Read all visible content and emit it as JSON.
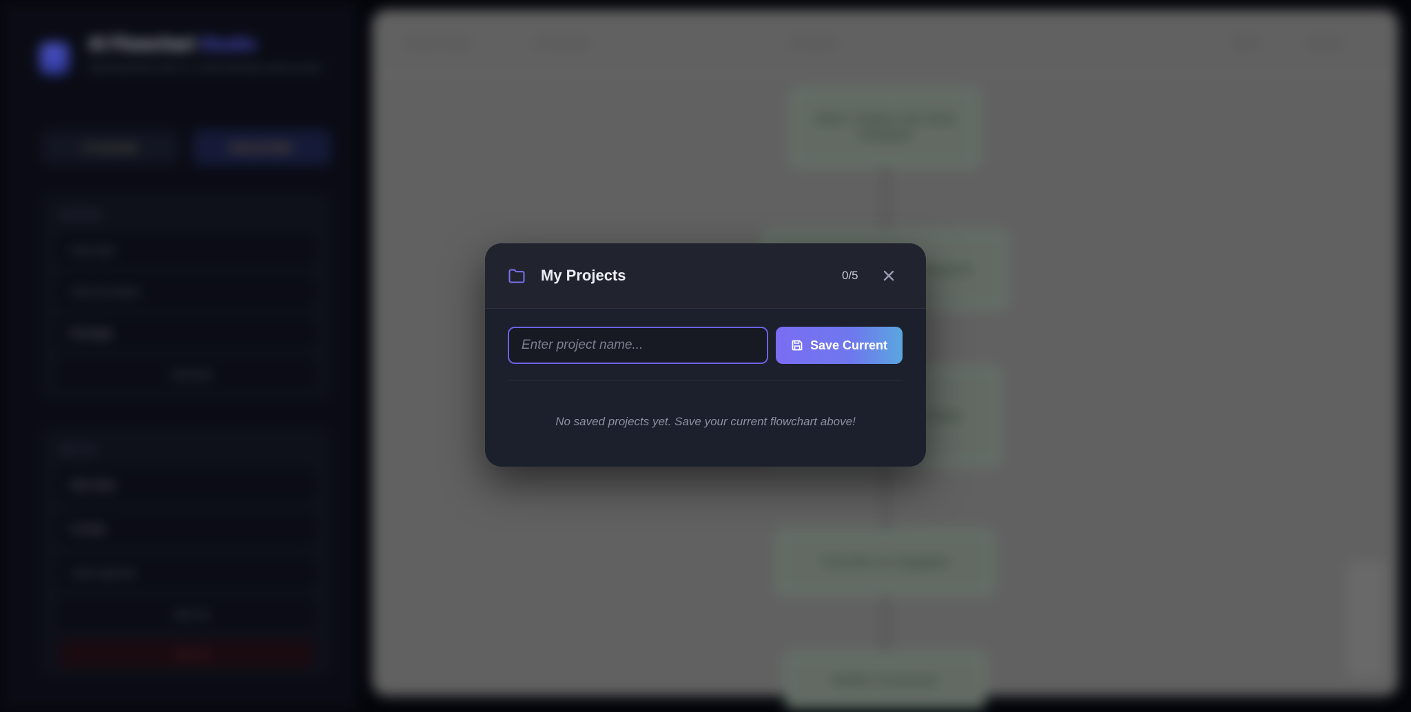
{
  "background_app": {
    "brand": {
      "title_main": "AI Flowchart",
      "title_accent": "Studio",
      "subtitle": "Build flowcharts with AI or write Mermaid code by hand"
    },
    "sidebar_tabs": [
      "AI Generate",
      "Manual Editor"
    ],
    "panel1": {
      "heading": "Add Node",
      "field1": "Node label",
      "field2": "Node description",
      "select": "Rectangle",
      "button": "Add Node"
    },
    "panel2": {
      "heading": "Add Link",
      "select_from": "Start Node",
      "select_to": "To Node",
      "field": "Label (optional)",
      "button_link": "Add Link",
      "button_clear": "Clear All"
    },
    "toolbar": [
      "Graph Name",
      "1 flowchart",
      "AI Assist",
      "Save",
      "Export"
    ],
    "flow_nodes": [
      "Start: Online Ad Click Initiated",
      "Process Payment Request",
      "Validate Customer Data",
      "Transfer to Supplier",
      "Notify Customer"
    ]
  },
  "modal": {
    "title": "My Projects",
    "count": "0/5",
    "input_placeholder": "Enter project name...",
    "input_value": "",
    "save_label": "Save Current",
    "empty_message": "No saved projects yet. Save your current flowchart above!",
    "icons": {
      "header": "folder-icon",
      "close": "close-icon",
      "save": "save-icon"
    },
    "colors": {
      "accent": "#6a63e4",
      "gradient_start": "#7a6df3",
      "gradient_end": "#5aa6df",
      "surface": "#1c1f2c"
    }
  }
}
